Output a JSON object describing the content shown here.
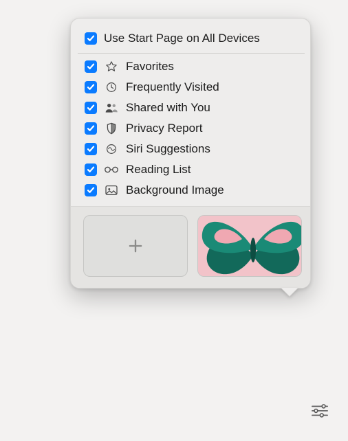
{
  "popover": {
    "header": {
      "checked": true,
      "label": "Use Start Page on All Devices"
    },
    "items": [
      {
        "id": "favorites",
        "checked": true,
        "icon": "star-icon",
        "label": "Favorites"
      },
      {
        "id": "frequently",
        "checked": true,
        "icon": "clock-icon",
        "label": "Frequently Visited"
      },
      {
        "id": "shared-with-you",
        "checked": true,
        "icon": "people-icon",
        "label": "Shared with You"
      },
      {
        "id": "privacy-report",
        "checked": true,
        "icon": "shield-icon",
        "label": "Privacy Report"
      },
      {
        "id": "siri-suggestions",
        "checked": true,
        "icon": "siri-icon",
        "label": "Siri Suggestions"
      },
      {
        "id": "reading-list",
        "checked": true,
        "icon": "glasses-icon",
        "label": "Reading List"
      },
      {
        "id": "background-image",
        "checked": true,
        "icon": "image-icon",
        "label": "Background Image"
      }
    ],
    "thumbnails": {
      "add_label": "Add custom background",
      "selected": "butterfly"
    }
  },
  "settings_button": "Customize Start Page"
}
